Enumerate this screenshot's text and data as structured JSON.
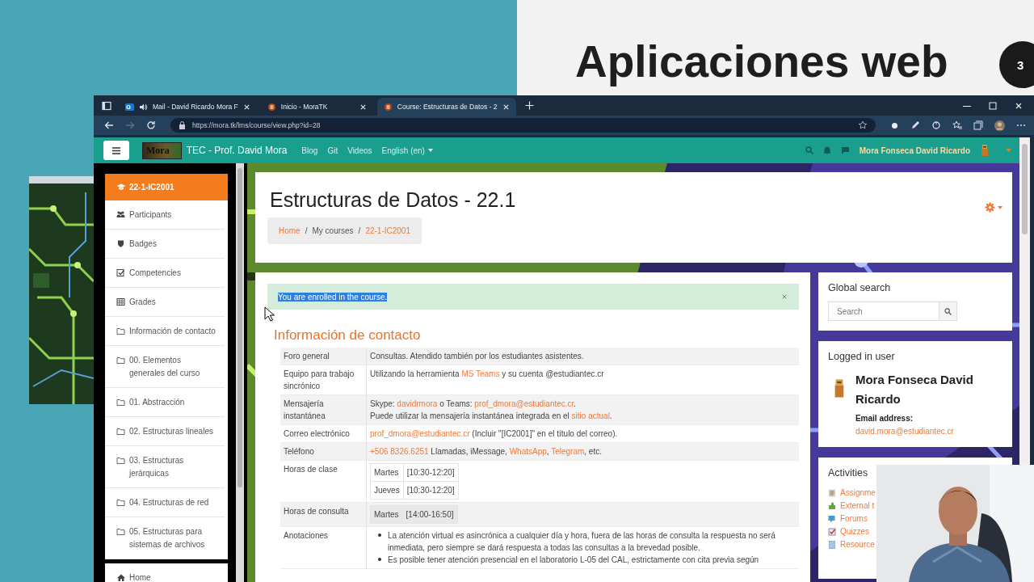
{
  "desktop": {
    "slide_title": "Aplicaciones web",
    "slide_number": "3"
  },
  "browser": {
    "tabs": [
      {
        "title": "Mail - David Ricardo Mora F",
        "kind": "mail",
        "selected": false
      },
      {
        "title": "Inicio - MoraTK",
        "kind": "site",
        "selected": false
      },
      {
        "title": "Course: Estructuras de Datos - 2",
        "kind": "site",
        "selected": true
      }
    ],
    "url": "https://mora.tk/lms/course/view.php?id=28"
  },
  "navbar": {
    "logo": "Mora",
    "site_name": "TEC - Prof. David Mora",
    "links": [
      "Blog",
      "Git",
      "Videos"
    ],
    "language": "English (en)",
    "user_name": "Mora Fonseca David Ricardo"
  },
  "sidebar": {
    "items": [
      {
        "label": "22-1-IC2001",
        "kind": "course",
        "selected": true
      },
      {
        "label": "Participants",
        "kind": "users",
        "selected": false
      },
      {
        "label": "Badges",
        "kind": "badge",
        "selected": false
      },
      {
        "label": "Competencies",
        "kind": "check",
        "selected": false
      },
      {
        "label": "Grades",
        "kind": "grid",
        "selected": false
      },
      {
        "label": "Información de contacto",
        "kind": "folder",
        "selected": false
      },
      {
        "label": "00. Elementos generales del curso",
        "kind": "folder",
        "selected": false
      },
      {
        "label": "01. Abstracción",
        "kind": "folder",
        "selected": false
      },
      {
        "label": "02. Estructuras lineales",
        "kind": "folder",
        "selected": false
      },
      {
        "label": "03. Estructuras jerárquicas",
        "kind": "folder",
        "selected": false
      },
      {
        "label": "04. Estructuras de red",
        "kind": "folder",
        "selected": false
      },
      {
        "label": "05. Estructuras para sistemas de archivos",
        "kind": "folder",
        "selected": false
      }
    ],
    "footer_items": [
      {
        "label": "Home",
        "kind": "home",
        "selected": false
      }
    ]
  },
  "header": {
    "title": "Estructuras de Datos - 22.1",
    "separator": "/",
    "breadcrumb": [
      {
        "label": "Home",
        "kind": "link"
      },
      {
        "label": "My courses",
        "kind": "text"
      },
      {
        "label": "22-1-IC2001",
        "kind": "link"
      }
    ]
  },
  "alert": {
    "message": "You are enrolled in the course.",
    "selected": true
  },
  "section": {
    "title": "Información de contacto",
    "rows": [
      {
        "label": "Foro general",
        "kind": "text",
        "lines": [
          [
            {
              "kind": "text",
              "text": "Consultas. Atendido también por los estudiantes asistentes."
            }
          ]
        ]
      },
      {
        "label": "Equipo para trabajo sincrónico",
        "kind": "text",
        "lines": [
          [
            {
              "kind": "text",
              "text": "Utilizando la herramienta "
            },
            {
              "kind": "link",
              "text": "MS Teams"
            },
            {
              "kind": "text",
              "text": " y su cuenta @estudiantec.cr"
            }
          ]
        ]
      },
      {
        "label": "Mensajería instantánea",
        "kind": "text",
        "lines": [
          [
            {
              "kind": "text",
              "text": "Skype: "
            },
            {
              "kind": "link",
              "text": "davidrmora"
            },
            {
              "kind": "text",
              "text": " o Teams: "
            },
            {
              "kind": "link",
              "text": "prof_dmora@estudiantec.cr"
            },
            {
              "kind": "text",
              "text": "."
            }
          ],
          [
            {
              "kind": "text",
              "text": "Puede utilizar la mensajería instantánea integrada en el "
            },
            {
              "kind": "link",
              "text": "sitio actual"
            },
            {
              "kind": "text",
              "text": "."
            }
          ]
        ]
      },
      {
        "label": "Correo electrónico",
        "kind": "text",
        "lines": [
          [
            {
              "kind": "link",
              "text": "prof_dmora@estudiantec.cr"
            },
            {
              "kind": "text",
              "text": " (Incluir \"[IC2001]\" en el título del correo)."
            }
          ]
        ]
      },
      {
        "label": "Teléfono",
        "kind": "text",
        "lines": [
          [
            {
              "kind": "link",
              "text": "+506 8326.6251"
            },
            {
              "kind": "text",
              "text": " Llamadas, iMessage, "
            },
            {
              "kind": "link",
              "text": "WhatsApp"
            },
            {
              "kind": "text",
              "text": ", "
            },
            {
              "kind": "link",
              "text": "Telegram"
            },
            {
              "kind": "text",
              "text": ", etc."
            }
          ]
        ]
      },
      {
        "label": "Horas de clase",
        "kind": "schedule",
        "slots": [
          {
            "day": "Martes",
            "time": "[10:30-12:20]"
          },
          {
            "day": "Jueves",
            "time": "[10:30-12:20]"
          }
        ]
      },
      {
        "label": "Horas de consulta",
        "kind": "schedule",
        "slots": [
          {
            "day": "Martes",
            "time": "[14:00-16:50]"
          }
        ]
      },
      {
        "label": "Anotaciones",
        "kind": "bullets",
        "items": [
          "La atención virtual es asincrónica a cualquier día y hora, fuera de las horas de consulta la respuesta no será inmediata, pero siempre se dará respuesta a todas las consultas a la brevedad posible.",
          "Es posible tener atención presencial en el laboratorio L-05 del CAL, estrictamente con cita previa según"
        ]
      }
    ]
  },
  "blocks": {
    "search": {
      "title": "Global search",
      "placeholder": "Search"
    },
    "user": {
      "title": "Logged in user",
      "name": "Mora Fonseca David Ricardo",
      "email_label": "Email address:",
      "email": "david.mora@estudiantec.cr"
    },
    "activities": {
      "title": "Activities",
      "items": [
        {
          "label": "Assignme",
          "kind": "assignment"
        },
        {
          "label": "External t",
          "kind": "external"
        },
        {
          "label": "Forums",
          "kind": "forum"
        },
        {
          "label": "Quizzes",
          "kind": "quiz"
        },
        {
          "label": "Resource",
          "kind": "resource"
        }
      ]
    }
  }
}
